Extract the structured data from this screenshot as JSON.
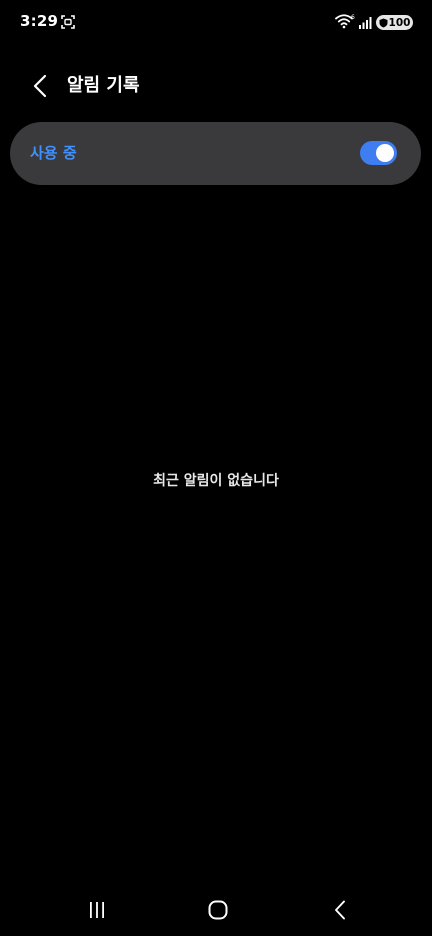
{
  "status_bar": {
    "time": "3:29",
    "battery_level": "100",
    "wifi_badge": "6",
    "icons": [
      "screenshot-icon",
      "wifi-icon",
      "signal-icon",
      "battery-icon"
    ]
  },
  "header": {
    "title": "알림 기록",
    "back_icon": "chevron-left-icon"
  },
  "master_switch": {
    "label": "사용 중",
    "enabled": true,
    "label_color": "#3e91ff",
    "track_color": "#3e7ef0"
  },
  "empty_state": {
    "message": "최근 알림이 없습니다"
  },
  "nav_bar": {
    "icons": [
      "recents-icon",
      "home-icon",
      "back-icon"
    ]
  },
  "colors": {
    "background": "#000000",
    "card": "#3a3a3c",
    "text": "#ffffff"
  }
}
